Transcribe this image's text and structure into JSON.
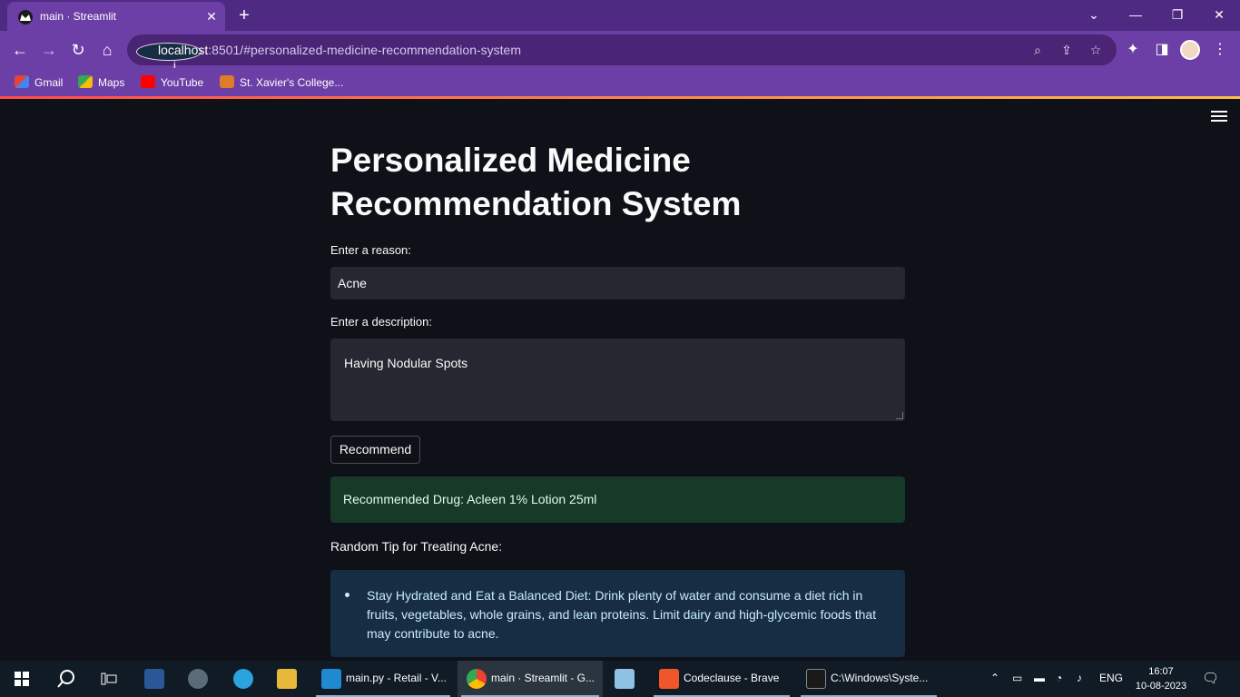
{
  "browser": {
    "tab_title": "main · Streamlit",
    "url_host": "localhost",
    "url_rest": ":8501/#personalized-medicine-recommendation-system",
    "bookmarks": [
      "Gmail",
      "Maps",
      "YouTube",
      "St. Xavier's College..."
    ]
  },
  "app": {
    "title": "Personalized Medicine Recommendation System",
    "reason_label": "Enter a reason:",
    "reason_value": "Acne",
    "description_label": "Enter a description:",
    "description_value": "Having Nodular Spots",
    "button_label": "Recommend",
    "result_text": "Recommended Drug: Acleen 1% Lotion 25ml",
    "tip_label": "Random Tip for Treating Acne:",
    "tip_text": "Stay Hydrated and Eat a Balanced Diet: Drink plenty of water and consume a diet rich in fruits, vegetables, whole grains, and lean proteins. Limit dairy and high-glycemic foods that may contribute to acne."
  },
  "taskbar": {
    "apps": [
      "main.py - Retail - V...",
      "main · Streamlit - G...",
      "Codeclause - Brave",
      "C:\\Windows\\Syste..."
    ],
    "lang": "ENG",
    "time": "16:07",
    "date": "10-08-2023"
  },
  "colors": {
    "browser_frame": "#6b3fa6",
    "app_bg": "#0e1117",
    "success_bg": "#173928",
    "info_bg": "#172d43"
  }
}
